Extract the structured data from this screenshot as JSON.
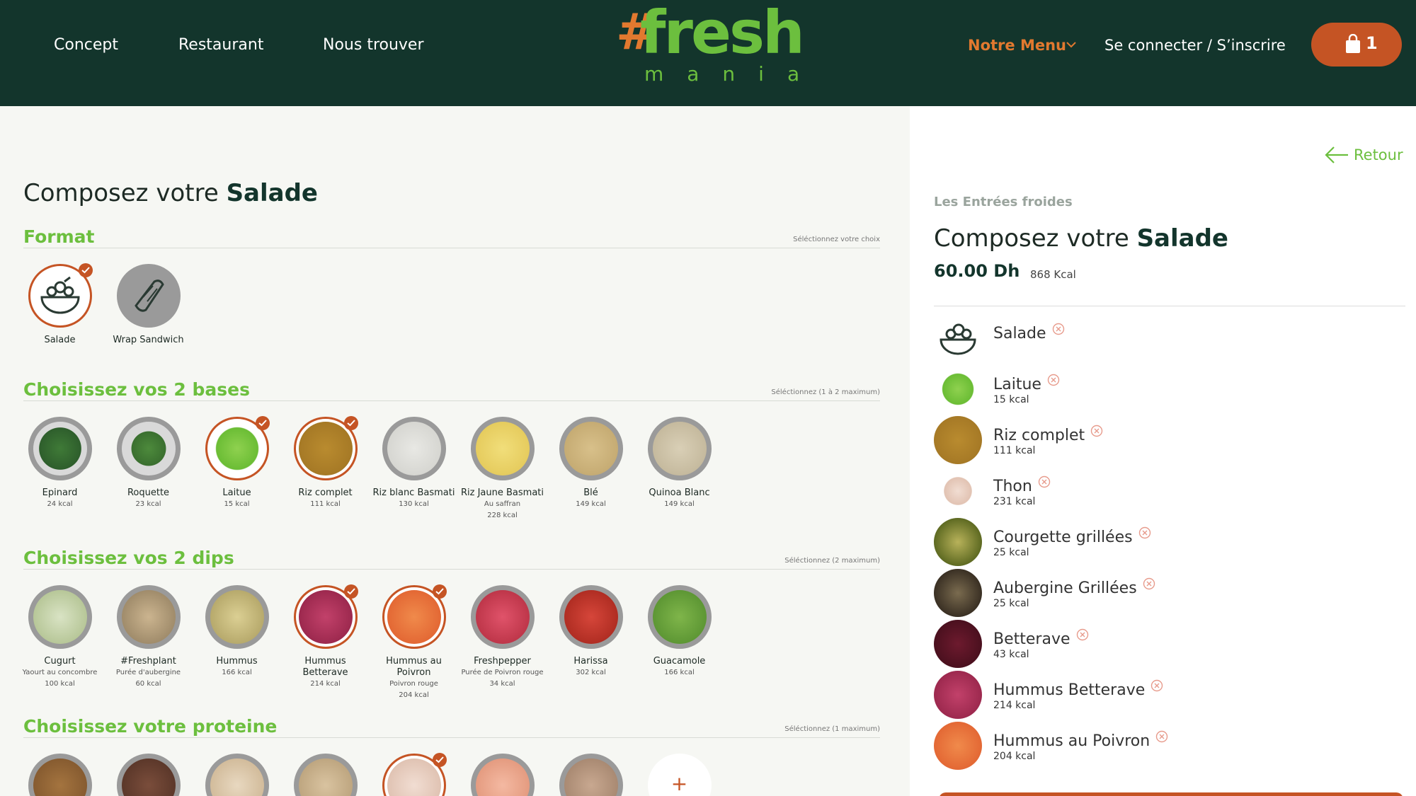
{
  "header": {
    "nav": [
      "Concept",
      "Restaurant",
      "Nous trouver"
    ],
    "logo_word": "fresh",
    "logo_sub": "mania",
    "menu_label": "Notre Menu",
    "login_label": "Se connecter / S’inscrire",
    "cart_count": "1"
  },
  "page": {
    "title_prefix": "Composez votre",
    "title_bold": "Salade"
  },
  "sections": {
    "format": {
      "title": "Format",
      "hint": "Séléctionnez votre choix",
      "options": [
        {
          "label": "Salade",
          "sub": "",
          "kcal": "",
          "selected": true,
          "icon": "salad-bowl-icon"
        },
        {
          "label": "Wrap Sandwich",
          "sub": "",
          "kcal": "",
          "selected": false,
          "icon": "wrap-icon"
        }
      ]
    },
    "bases": {
      "title": "Choisissez vos 2 bases",
      "hint": "Séléctionnez (1 à 2 maximum)",
      "options": [
        {
          "label": "Epinard",
          "sub": "",
          "kcal": "24 kcal",
          "selected": false
        },
        {
          "label": "Roquette",
          "sub": "",
          "kcal": "23 kcal",
          "selected": false
        },
        {
          "label": "Laitue",
          "sub": "",
          "kcal": "15 kcal",
          "selected": true
        },
        {
          "label": "Riz complet",
          "sub": "",
          "kcal": "111 kcal",
          "selected": true
        },
        {
          "label": "Riz blanc Basmati",
          "sub": "",
          "kcal": "130 kcal",
          "selected": false
        },
        {
          "label": "Riz Jaune Basmati",
          "sub": "Au saffran",
          "kcal": "228 kcal",
          "selected": false
        },
        {
          "label": "Blé",
          "sub": "",
          "kcal": "149 kcal",
          "selected": false
        },
        {
          "label": "Quinoa Blanc",
          "sub": "",
          "kcal": "149 kcal",
          "selected": false
        }
      ]
    },
    "dips": {
      "title": "Choisissez vos 2 dips",
      "hint": "Séléctionnez (2 maximum)",
      "options": [
        {
          "label": "Cugurt",
          "sub": "Yaourt au concombre",
          "kcal": "100 kcal",
          "selected": false
        },
        {
          "label": "#Freshplant",
          "sub": "Purée d'aubergine",
          "kcal": "60 kcal",
          "selected": false
        },
        {
          "label": "Hummus",
          "sub": "",
          "kcal": "166 kcal",
          "selected": false
        },
        {
          "label": "Hummus Betterave",
          "sub": "",
          "kcal": "214 kcal",
          "selected": true
        },
        {
          "label": "Hummus au Poivron",
          "sub": "Poivron rouge",
          "kcal": "204 kcal",
          "selected": true
        },
        {
          "label": "Freshpepper",
          "sub": "Purée de Poivron rouge",
          "kcal": "34 kcal",
          "selected": false
        },
        {
          "label": "Harissa",
          "sub": "",
          "kcal": "302 kcal",
          "selected": false
        },
        {
          "label": "Guacamole",
          "sub": "",
          "kcal": "166 kcal",
          "selected": false
        }
      ]
    },
    "proteine": {
      "title": "Choisissez votre proteine",
      "hint": "Séléctionnez (1 maximum)",
      "options": [
        {
          "selected": false
        },
        {
          "selected": false
        },
        {
          "selected": false
        },
        {
          "selected": false
        },
        {
          "selected": true
        },
        {
          "selected": false
        },
        {
          "selected": false
        }
      ],
      "more": "+"
    }
  },
  "summary": {
    "back_label": "Retour",
    "category": "Les Entrées froides",
    "title_prefix": "Composez votre",
    "title_bold": "Salade",
    "price": "60.00 Dh",
    "kcal": "868 Kcal",
    "items": [
      {
        "name": "Salade",
        "kcal": ""
      },
      {
        "name": "Laitue",
        "kcal": "15 kcal"
      },
      {
        "name": "Riz complet",
        "kcal": "111 kcal"
      },
      {
        "name": "Thon",
        "kcal": "231 kcal"
      },
      {
        "name": "Courgette grillées",
        "kcal": "25 kcal"
      },
      {
        "name": "Aubergine Grillées",
        "kcal": "25 kcal"
      },
      {
        "name": "Betterave",
        "kcal": "43 kcal"
      },
      {
        "name": "Hummus Betterave",
        "kcal": "214 kcal"
      },
      {
        "name": "Hummus au Poivron",
        "kcal": "204 kcal"
      }
    ]
  },
  "colors": {
    "header_bg": "#13352c",
    "brand_green": "#6cbf3e",
    "accent_orange": "#c55424"
  }
}
